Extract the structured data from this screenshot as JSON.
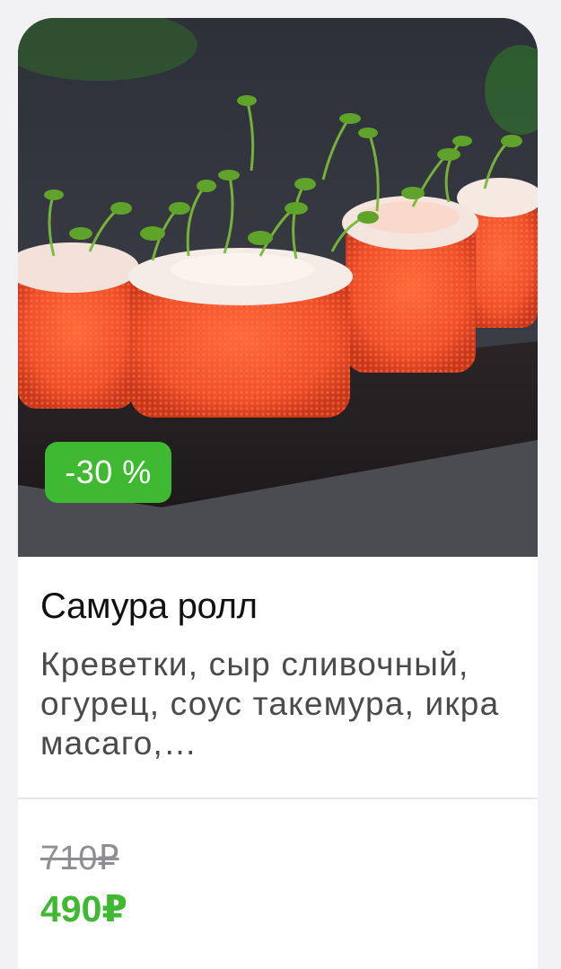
{
  "product": {
    "discount_badge": "-30 %",
    "title": "Самура ролл",
    "description": "Креветки, сыр сливочный, огурец, соус такемура, икра масаго,…",
    "old_price": "710₽",
    "new_price": "490₽",
    "image": "sushi-roll-photo"
  },
  "colors": {
    "accent_green": "#3fb832",
    "old_price_gray": "#8e8e93",
    "roll_orange": "#f0502a"
  }
}
